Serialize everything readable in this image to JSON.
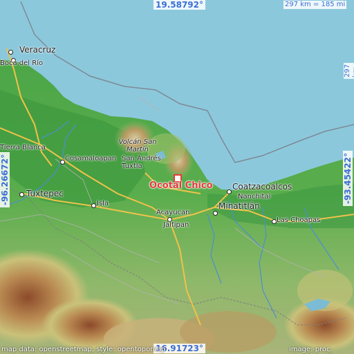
{
  "map": {
    "place_name": "Ocotal Chico",
    "top_latitude": "19.58792°",
    "bottom_latitude": "16.91723°",
    "left_longitude": "-96.26672°",
    "right_longitude": "-93.45422°",
    "scale_horizontal": "297 km = 185 mi",
    "scale_vertical": "297 km = 185 mi",
    "credit_left": "map data: openstreetmap, style: opentopomap",
    "credit_right": "image: proc. elevation city"
  },
  "cities": {
    "veracruz": "Veracruz",
    "boca": "Boca del Río",
    "sierra_blanca": "Tierra Blanca",
    "cosamaloapan": "Cosamaloapan",
    "volcan": "Volcán San Martín",
    "san_andres": "San Andrés Tuxtla",
    "tuxtepec": "Tuxtepec",
    "isla": "Isla",
    "acayucan": "Acayucan",
    "jaltipan": "Jáltipan",
    "minatitlan": "Minatitlán",
    "coatzacoalcos": "Coatzacoalcos",
    "nanchital": "Nanchital",
    "las_choapas": "Las Choapas"
  }
}
